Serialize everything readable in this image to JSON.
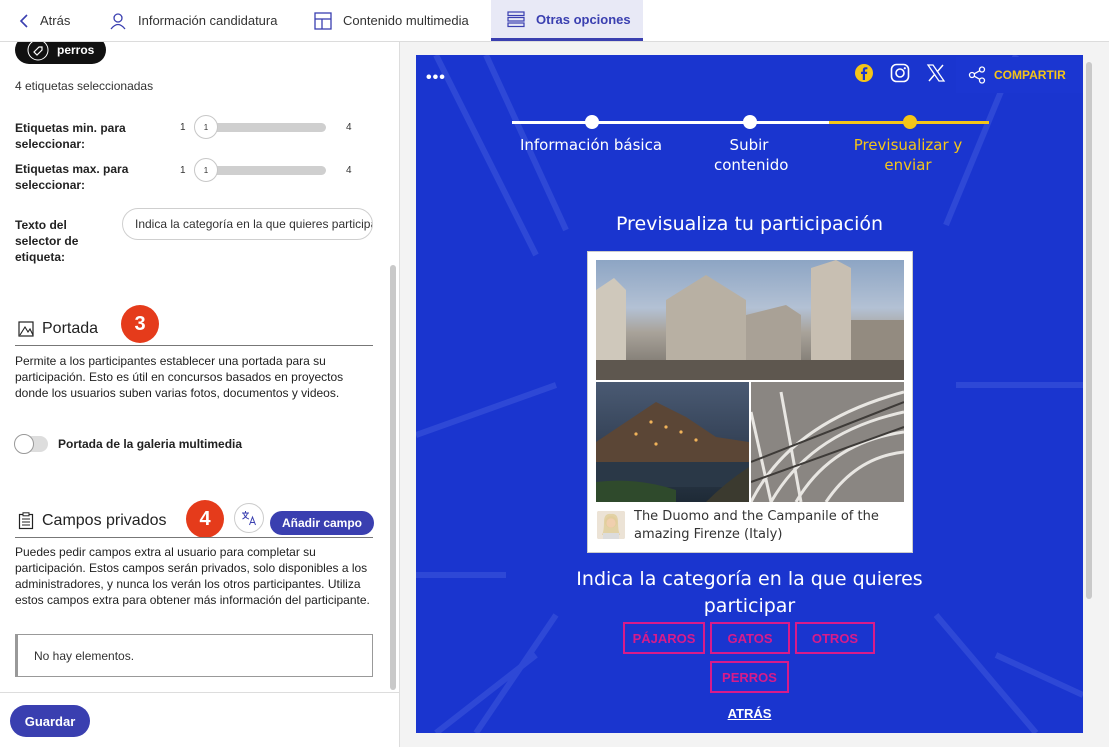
{
  "tabs": [
    {
      "label": "Atrás"
    },
    {
      "label": "Información candidatura"
    },
    {
      "label": "Contenido multimedia"
    },
    {
      "label": "Otras opciones"
    }
  ],
  "tags": {
    "chip_label": "perros",
    "selected_count": "4 etiquetas seleccionadas",
    "min_label": "Etiquetas min. para seleccionar:",
    "min_low": "1",
    "min_value": "1",
    "min_high": "4",
    "max_label": "Etiquetas max. para seleccionar:",
    "max_low": "1",
    "max_value": "1",
    "max_high": "4",
    "selector_label": "Texto del selector de etiqueta:",
    "selector_value": "Indica la categoría en la que quieres participar"
  },
  "portada": {
    "title": "Portada",
    "badge": "3",
    "description": "Permite a los participantes establecer una portada para su participación. Esto es útil en concursos basados en proyectos donde los usuarios suben varias fotos, documentos y videos.",
    "toggle_label": "Portada de la galeria multimedia",
    "toggle_on": false
  },
  "private_fields": {
    "title": "Campos privados",
    "badge": "4",
    "add_label": "Añadir campo",
    "description": "Puedes pedir campos extra al usuario para completar su participación. Estos campos serán privados, solo disponibles a los administradores, y nunca los verán los otros participantes. Utiliza estos campos extra para obtener más información del participante.",
    "empty": "No hay elementos."
  },
  "footer": {
    "save_label": "Guardar"
  },
  "preview": {
    "menu_dots": "•••",
    "share_label": "COMPARTIR",
    "steps": [
      {
        "label": "Información básica"
      },
      {
        "label": "Subir contenido"
      },
      {
        "label": "Previsualizar y enviar"
      }
    ],
    "title": "Previsualiza tu participación",
    "caption": "The Duomo and the Campanile of the amazing Firenze (Italy)",
    "category_title": "Indica la categoría en la que quieres participar",
    "categories": [
      "PÁJAROS",
      "GATOS",
      "OTROS",
      "PERROS"
    ],
    "back_label": "ATRÁS"
  },
  "colors": {
    "accent": "#3a3fb0",
    "preview_bg": "#1a35cf",
    "step_active": "#f5c518",
    "category": "#d81b8a",
    "badge": "#e53b1b"
  }
}
